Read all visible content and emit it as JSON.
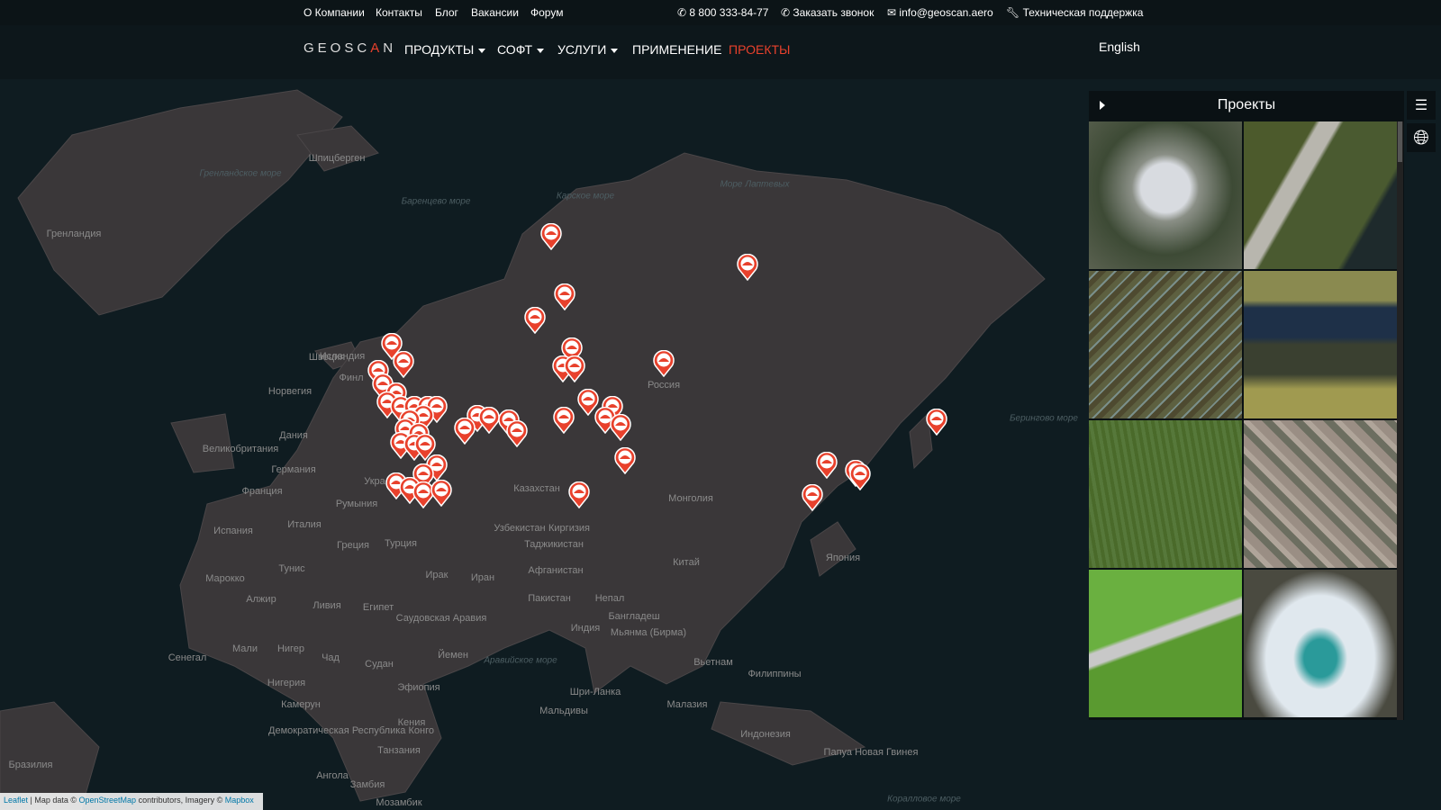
{
  "topbar": {
    "links": [
      "О Компании",
      "Контакты",
      "Блог",
      "Вакансии",
      "Форум"
    ],
    "phone": "8 800 333-84-77",
    "callback": "Заказать звонок",
    "email": "info@geoscan.aero",
    "support": "Техническая поддержка"
  },
  "navbar": {
    "logo": "GEOSCAN",
    "items": [
      {
        "label": "ПРОДУКТЫ",
        "dropdown": true
      },
      {
        "label": "СОФТ",
        "dropdown": true
      },
      {
        "label": "УСЛУГИ",
        "dropdown": true
      },
      {
        "label": "ПРИМЕНЕНИЕ",
        "dropdown": false
      },
      {
        "label": "ПРОЕКТЫ",
        "dropdown": false,
        "active": true
      }
    ],
    "language": "English",
    "accent": "#e8412c"
  },
  "panel": {
    "title": "Проекты",
    "thumbnails": [
      "cathedral",
      "road-forest",
      "power-tower",
      "quarry",
      "field",
      "city-block",
      "road-field",
      "mountain-lake"
    ]
  },
  "map": {
    "labels": [
      "Гренландия",
      "Исландия",
      "Норвегия",
      "Швеция",
      "Финл",
      "Дания",
      "Великобритания",
      "Германия",
      "Франция",
      "Испания",
      "Италия",
      "Румыния",
      "Укра",
      "Греция",
      "Турция",
      "Россия",
      "Казахстан",
      "Монголия",
      "Китай",
      "Япония",
      "Узбекистан",
      "Киргизия",
      "Таджикистан",
      "Афганистан",
      "Пакистан",
      "Иран",
      "Ирак",
      "Непал",
      "Индия",
      "Бангладеш",
      "Мьянма (Бирма)",
      "Вьетнам",
      "Филиппины",
      "Малазия",
      "Индонезия",
      "Папуа Новая Гвинея",
      "Шри-Ланка",
      "Мальдивы",
      "Марокко",
      "Алжир",
      "Тунис",
      "Ливия",
      "Египет",
      "Саудовская Аравия",
      "Йемен",
      "Мали",
      "Нигер",
      "Чад",
      "Судан",
      "Эфиопия",
      "Сенегал",
      "Нигерия",
      "Камерун",
      "Демократическая Республика Конго",
      "Кения",
      "Танзания",
      "Ангола",
      "Замбия",
      "Мозамбик",
      "Бразилия",
      "Шпицберген"
    ],
    "seas": [
      "Гренландское море",
      "Баренцево море",
      "Карское море",
      "Море Лаптевых",
      "Берингово море",
      "Аравийское море",
      "Коралловое море"
    ],
    "marker_color": "#e8412c"
  },
  "attribution": {
    "leaflet": "Leaflet",
    "text1": " | Map data © ",
    "osm": "OpenStreetMap",
    "text2": " contributors, Imagery © ",
    "mapbox": "Mapbox"
  }
}
